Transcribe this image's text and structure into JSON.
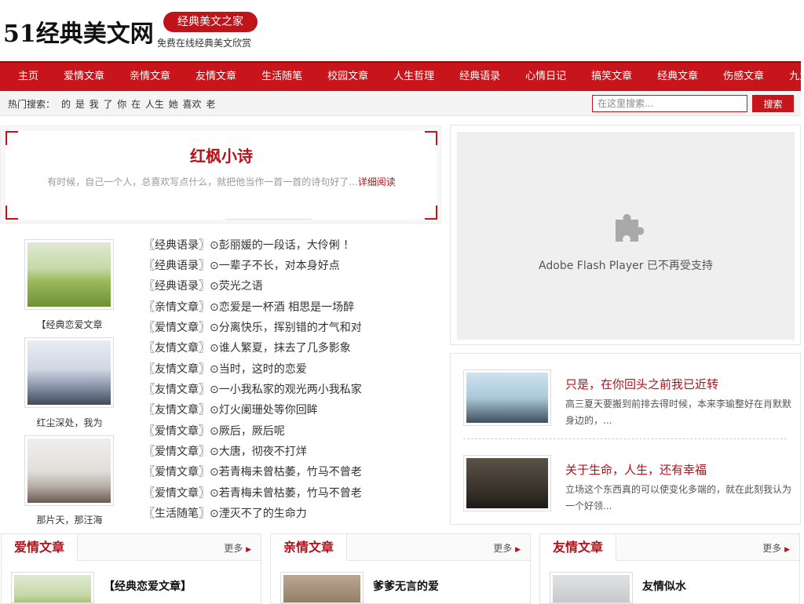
{
  "header": {
    "logo": "51经典美文网",
    "tagline_pill": "经典美文之家",
    "tagline_sub": "免费在线经典美文欣赏"
  },
  "nav": {
    "items": [
      "主页",
      "爱情文章",
      "亲情文章",
      "友情文章",
      "生活随笔",
      "校园文章",
      "人生哲理",
      "经典语录",
      "心情日记",
      "搞笑文章",
      "经典文章",
      "伤感文章",
      "九九文章"
    ]
  },
  "search": {
    "hot_label": "热门搜索：",
    "hot_words": "的 是 我 了 你 在 人生 她 喜欢 老",
    "placeholder": "在这里搜索...",
    "button_label": "搜索"
  },
  "feature": {
    "title": "红枫小诗",
    "desc": "有时候，自己一个人，总喜欢写点什么，就把他当作一首一首的诗句好了...",
    "more": "详细阅读"
  },
  "thumbs": [
    {
      "caption": "【经典恋爱文章"
    },
    {
      "caption": "红尘深处，我为"
    },
    {
      "caption": "那片天，那汪海"
    }
  ],
  "articles": [
    {
      "cat": "〖经典语录〗",
      "title": "⊙彭丽媛的一段话，大伶俐 ！"
    },
    {
      "cat": "〖经典语录〗",
      "title": "⊙一辈子不长，对本身好点"
    },
    {
      "cat": "〖经典语录〗",
      "title": "⊙荧光之语"
    },
    {
      "cat": "〖亲情文章〗",
      "title": "⊙恋爱是一杯酒 相思是一场醉"
    },
    {
      "cat": "〖爱情文章〗",
      "title": "⊙分离快乐，挥别错的才气和对"
    },
    {
      "cat": "〖友情文章〗",
      "title": "⊙谁人繁夏，抹去了几多影象"
    },
    {
      "cat": "〖友情文章〗",
      "title": "⊙当时，这时的恋爱"
    },
    {
      "cat": "〖友情文章〗",
      "title": "⊙一小我私家的观光两小我私家"
    },
    {
      "cat": "〖友情文章〗",
      "title": "⊙灯火阑珊处等你回眸"
    },
    {
      "cat": "〖爱情文章〗",
      "title": "⊙厥后，厥后呢"
    },
    {
      "cat": "〖爱情文章〗",
      "title": "⊙大唐，彻夜不打烊"
    },
    {
      "cat": "〖爱情文章〗",
      "title": "⊙若青梅未曾枯萎，竹马不曾老"
    },
    {
      "cat": "〖爱情文章〗",
      "title": "⊙若青梅未曾枯萎，竹马不曾老"
    },
    {
      "cat": "〖生活随笔〗",
      "title": "⊙湮灭不了的生命力"
    }
  ],
  "flash": {
    "message": "Adobe Flash Player 已不再受支持",
    "icon": "puzzle-plugin-icon"
  },
  "side_stories": [
    {
      "title": "只是，在你回头之前我已近转",
      "desc": "高三夏天要搬到前排去得时候，本来李瑜整好在肖默默身边的，..."
    },
    {
      "title": "关于生命，人生，还有幸福",
      "desc": "立场这个东西真的可以使变化多端的，就在此刻我认为一个好领..."
    }
  ],
  "categories": [
    {
      "name": "爱情文章",
      "more": "更多",
      "first_title": "【经典恋爱文章】"
    },
    {
      "name": "亲情文章",
      "more": "更多",
      "first_title": "爹爹无言的爱"
    },
    {
      "name": "友情文章",
      "more": "更多",
      "first_title": "友情似水"
    }
  ],
  "colors": {
    "brand_red": "#c8151b",
    "title_red": "#b3121a"
  }
}
